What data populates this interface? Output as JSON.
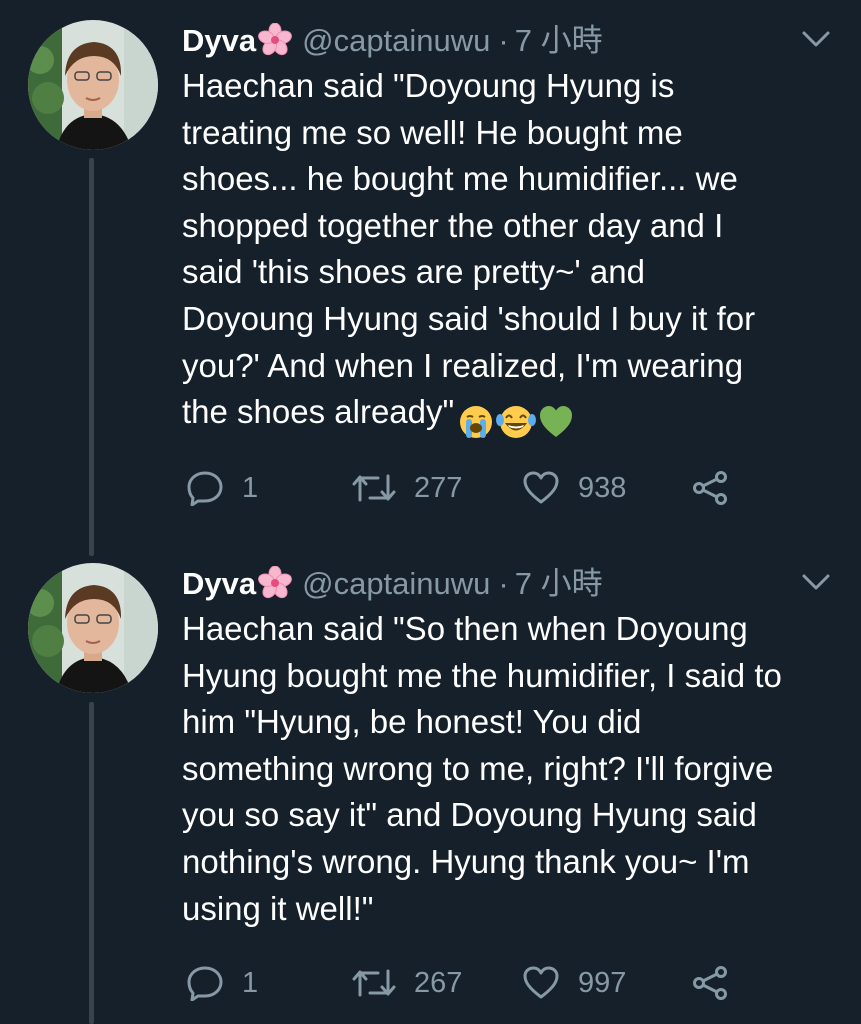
{
  "tweets": [
    {
      "name": "Dyva",
      "handle": "@captainuwu",
      "separator": "·",
      "time": "7 小時",
      "text": "Haechan said \"Doyoung Hyung is\ntreating me so well! He bought me\nshoes... he bought me humidifier... we\nshopped together the other day and I\nsaid 'this shoes are pretty~' and\nDoyoung Hyung said 'should I buy it for\nyou?' And when I realized, I'm wearing\nthe shoes already\"",
      "emojis": [
        "loudly-crying-face",
        "tears-of-joy-face",
        "green-heart"
      ],
      "replies": "1",
      "retweets": "277",
      "likes": "938"
    },
    {
      "name": "Dyva",
      "handle": "@captainuwu",
      "separator": "·",
      "time": "7 小時",
      "text": "Haechan said \"So then when Doyoung\nHyung bought me the humidifier, I said to\nhim \"Hyung, be honest! You did\nsomething wrong to me, right? I'll forgive\nyou so say it\" and Doyoung Hyung said\nnothing's wrong. Hyung thank you~ I'm\nusing it well!\"",
      "emojis": [],
      "replies": "1",
      "retweets": "267",
      "likes": "997"
    }
  ],
  "colors": {
    "background": "#15202b",
    "text": "#ffffff",
    "secondary": "#8899a6",
    "thread_line": "#38444d"
  },
  "icons": {
    "caret": "chevron-down-icon",
    "reply": "reply-icon",
    "retweet": "retweet-icon",
    "like": "heart-icon",
    "share": "share-icon",
    "name_emoji": "cherry-blossom-icon"
  }
}
